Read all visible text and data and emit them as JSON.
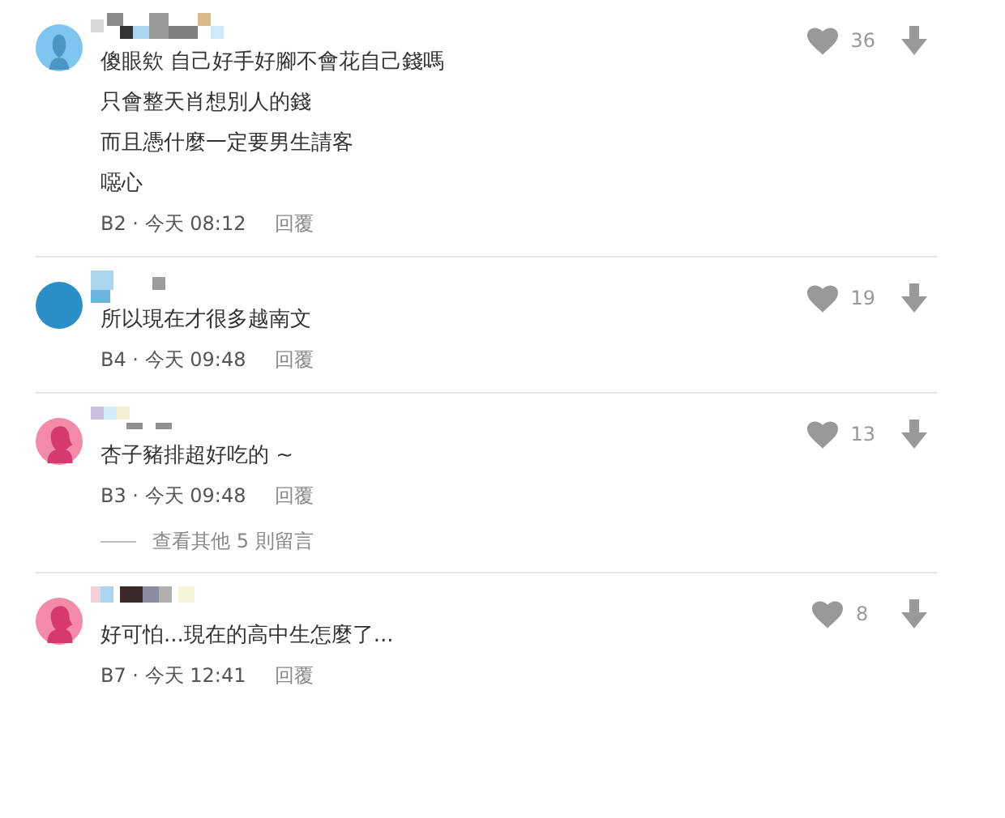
{
  "comments": [
    {
      "avatar": {
        "color": "#7fc6ee",
        "kind": "bust"
      },
      "lines": [
        "傻眼欸 自己好手好腳不會花自己錢嗎",
        "只會整天肖想別人的錢",
        "而且憑什麼一定要男生請客",
        "噁心"
      ],
      "meta": "B2 · 今天 08:12",
      "reply": "回覆",
      "likes": "36"
    },
    {
      "avatar": {
        "color": "#2b8fc7",
        "kind": "plain"
      },
      "lines": [
        "所以現在才很多越南文"
      ],
      "meta": "B4 · 今天 09:48",
      "reply": "回覆",
      "likes": "19"
    },
    {
      "avatar": {
        "color": "#f28aa8",
        "kind": "girl"
      },
      "lines": [
        "杏子豬排超好吃的 ~"
      ],
      "meta": "B3 · 今天 09:48",
      "reply": "回覆",
      "likes": "13",
      "more_replies": "查看其他 5 則留言"
    },
    {
      "avatar": {
        "color": "#f28aa8",
        "kind": "girl"
      },
      "lines": [
        "好可怕...現在的高中生怎麼了..."
      ],
      "meta": "B7 · 今天 12:41",
      "reply": "回覆",
      "likes": "8"
    }
  ]
}
